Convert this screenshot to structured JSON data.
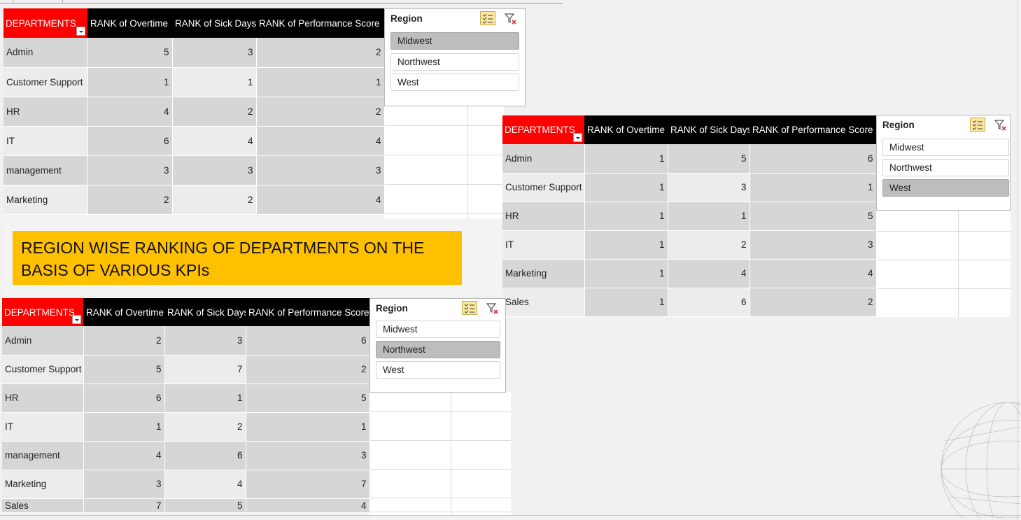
{
  "banner": {
    "text": "REGION WISE RANKING OF DEPARTMENTS ON THE BASIS OF VARIOUS KPIs"
  },
  "pivots": [
    {
      "headers": [
        "DEPARTMENTS",
        "RANK of Overtime",
        "RANK of Sick Days",
        "RANK of Performance Score"
      ],
      "rows": [
        [
          "Admin",
          "5",
          "3",
          "2"
        ],
        [
          "Customer Support",
          "1",
          "1",
          "1"
        ],
        [
          "HR",
          "4",
          "2",
          "2"
        ],
        [
          "IT",
          "6",
          "4",
          "4"
        ],
        [
          "management",
          "3",
          "3",
          "3"
        ],
        [
          "Marketing",
          "2",
          "2",
          "4"
        ]
      ],
      "slicer": {
        "title": "Region",
        "items": [
          "Midwest",
          "Northwest",
          "West"
        ],
        "selected": "Midwest"
      }
    },
    {
      "headers": [
        "DEPARTMENTS",
        "RANK of Overtime",
        "RANK of Sick Days",
        "RANK of Performance Score"
      ],
      "rows": [
        [
          "Admin",
          "1",
          "5",
          "6"
        ],
        [
          "Customer Support",
          "1",
          "3",
          "1"
        ],
        [
          "HR",
          "1",
          "1",
          "5"
        ],
        [
          "IT",
          "1",
          "2",
          "3"
        ],
        [
          "Marketing",
          "1",
          "4",
          "4"
        ],
        [
          "Sales",
          "1",
          "6",
          "2"
        ]
      ],
      "slicer": {
        "title": "Region",
        "items": [
          "Midwest",
          "Northwest",
          "West"
        ],
        "selected": "West"
      }
    },
    {
      "headers": [
        "DEPARTMENTS",
        "RANK of Overtime",
        "RANK of Sick Days",
        "RANK of Performance Score"
      ],
      "rows": [
        [
          "Admin",
          "2",
          "3",
          "6"
        ],
        [
          "Customer Support",
          "5",
          "7",
          "2"
        ],
        [
          "HR",
          "6",
          "1",
          "5"
        ],
        [
          "IT",
          "1",
          "2",
          "1"
        ],
        [
          "management",
          "4",
          "6",
          "3"
        ],
        [
          "Marketing",
          "3",
          "4",
          "7"
        ],
        [
          "Sales",
          "7",
          "5",
          "4"
        ]
      ],
      "slicer": {
        "title": "Region",
        "items": [
          "Midwest",
          "Northwest",
          "West"
        ],
        "selected": "Northwest"
      }
    }
  ],
  "colors": {
    "header_red": "#ff0000",
    "header_black": "#000000",
    "banner_yellow": "#ffc000",
    "selected_item": "#bdbdbd"
  },
  "icons": {
    "multi_select": "multi-select-icon",
    "clear_filter": "clear-filter-icon",
    "dropdown": "filter-dropdown-icon"
  }
}
